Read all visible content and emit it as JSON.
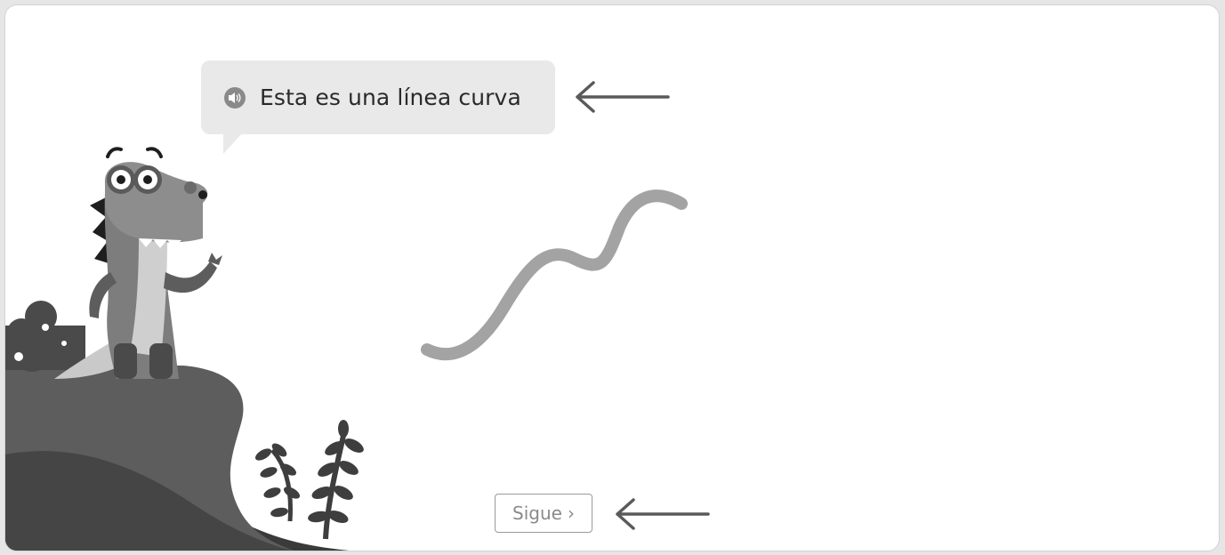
{
  "lesson": {
    "speech_text": "Esta es una línea curva",
    "next_label": "Sigue",
    "next_chevron": "›"
  },
  "icons": {
    "speaker": "speaker-icon",
    "chevron": "chevron-right-icon",
    "arrow": "arrow-left-icon"
  },
  "colors": {
    "curve": "#a3a3a3",
    "bubble": "#e9e9e9",
    "button_border": "#9a9a9a",
    "button_text": "#8a8a8a"
  }
}
